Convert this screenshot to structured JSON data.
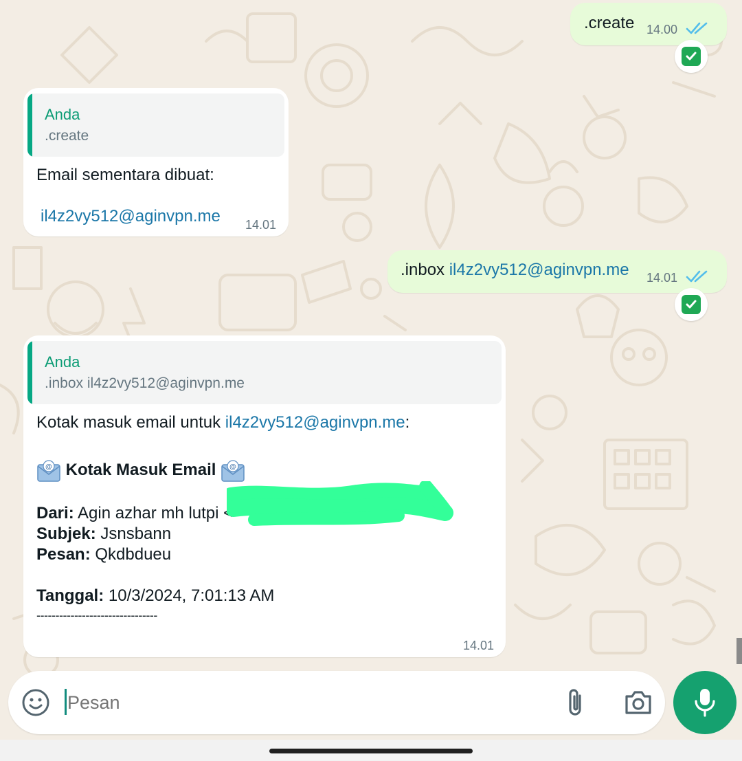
{
  "messages": [
    {
      "type": "outgoing",
      "text": ".create",
      "time": "14.00"
    },
    {
      "type": "incoming",
      "quote": {
        "author": "Anda",
        "text": ".create"
      },
      "line1": "Email sementara dibuat:",
      "email": "il4z2vy512@aginvpn.me",
      "time": "14.01"
    },
    {
      "type": "outgoing",
      "prefix": ".inbox",
      "email": "il4z2vy512@aginvpn.me",
      "time": "14.01"
    },
    {
      "type": "incoming",
      "quote": {
        "author": "Anda",
        "text": ".inbox il4z2vy512@aginvpn.me"
      },
      "intro_text": "Kotak masuk email untuk",
      "intro_email": "il4z2vy512@aginvpn.me",
      "intro_colon": ":",
      "heading": "Kotak Masuk Email",
      "from_label": "Dari:",
      "from_value": "Agin azhar mh lutpi <",
      "subject_label": "Subjek:",
      "subject_value": "Jsnsbann",
      "message_label": "Pesan:",
      "message_value": "Qkdbdueu",
      "date_label": "Tanggal:",
      "date_value": "10/3/2024, 7:01:13 AM",
      "separator": "--------------------------------",
      "time": "14.01"
    }
  ],
  "composer": {
    "placeholder": "Pesan"
  },
  "icons": {
    "emoji": "emoji-icon",
    "attach": "paperclip-icon",
    "camera": "camera-icon",
    "mic": "microphone-icon",
    "read": "double-check-icon",
    "reaction": "check-box-emoji-icon",
    "envelope": "incoming-envelope-icon"
  },
  "colors": {
    "outgoing_bubble": "#e7fbd9",
    "incoming_bubble": "#ffffff",
    "accent": "#15a16f",
    "link": "#1b77a8",
    "redaction": "#33ff99",
    "read_ticks": "#53bdeb"
  }
}
